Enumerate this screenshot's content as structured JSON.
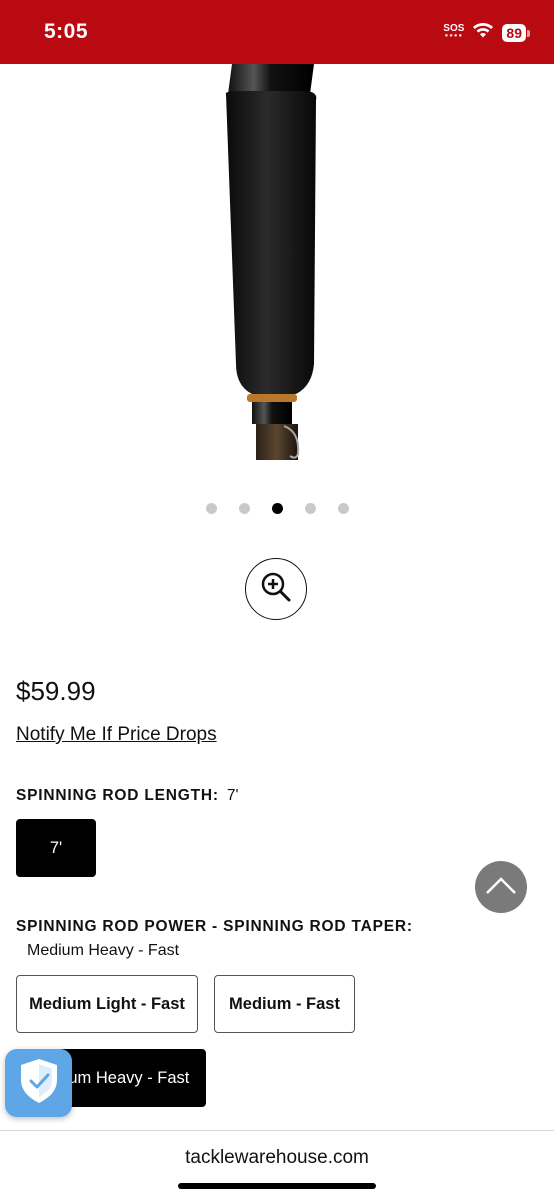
{
  "status_bar": {
    "time": "5:05",
    "sos": "SOS",
    "battery": "89",
    "color": "#b80a10"
  },
  "gallery": {
    "dot_count": 5,
    "active_dot": 3
  },
  "product": {
    "price": "$59.99",
    "notify_link": "Notify Me If Price Drops"
  },
  "length_option": {
    "label": "SPINNING ROD LENGTH:",
    "selected": "7'",
    "buttons": [
      "7'"
    ]
  },
  "power_option": {
    "label": "SPINNING ROD POWER - SPINNING ROD TAPER:",
    "selected": "Medium Heavy - Fast",
    "buttons": [
      "Medium Light - Fast",
      "Medium - Fast",
      "Medium Heavy - Fast"
    ]
  },
  "browser": {
    "url": "tacklewarehouse.com"
  },
  "icons": {
    "zoom": "zoom-in-icon",
    "scroll_top": "chevron-up-icon",
    "shield": "shield-check-icon",
    "wifi": "wifi-icon"
  }
}
